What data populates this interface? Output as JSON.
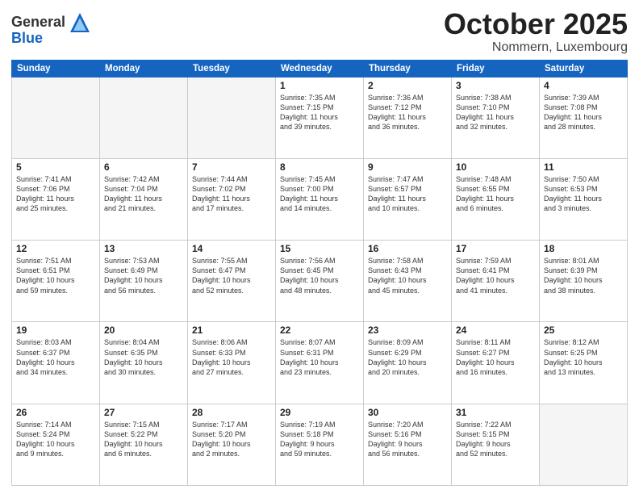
{
  "header": {
    "logo_general": "General",
    "logo_blue": "Blue",
    "month_title": "October 2025",
    "location": "Nommern, Luxembourg"
  },
  "weekdays": [
    "Sunday",
    "Monday",
    "Tuesday",
    "Wednesday",
    "Thursday",
    "Friday",
    "Saturday"
  ],
  "weeks": [
    [
      {
        "day": "",
        "info": ""
      },
      {
        "day": "",
        "info": ""
      },
      {
        "day": "",
        "info": ""
      },
      {
        "day": "1",
        "info": "Sunrise: 7:35 AM\nSunset: 7:15 PM\nDaylight: 11 hours\nand 39 minutes."
      },
      {
        "day": "2",
        "info": "Sunrise: 7:36 AM\nSunset: 7:12 PM\nDaylight: 11 hours\nand 36 minutes."
      },
      {
        "day": "3",
        "info": "Sunrise: 7:38 AM\nSunset: 7:10 PM\nDaylight: 11 hours\nand 32 minutes."
      },
      {
        "day": "4",
        "info": "Sunrise: 7:39 AM\nSunset: 7:08 PM\nDaylight: 11 hours\nand 28 minutes."
      }
    ],
    [
      {
        "day": "5",
        "info": "Sunrise: 7:41 AM\nSunset: 7:06 PM\nDaylight: 11 hours\nand 25 minutes."
      },
      {
        "day": "6",
        "info": "Sunrise: 7:42 AM\nSunset: 7:04 PM\nDaylight: 11 hours\nand 21 minutes."
      },
      {
        "day": "7",
        "info": "Sunrise: 7:44 AM\nSunset: 7:02 PM\nDaylight: 11 hours\nand 17 minutes."
      },
      {
        "day": "8",
        "info": "Sunrise: 7:45 AM\nSunset: 7:00 PM\nDaylight: 11 hours\nand 14 minutes."
      },
      {
        "day": "9",
        "info": "Sunrise: 7:47 AM\nSunset: 6:57 PM\nDaylight: 11 hours\nand 10 minutes."
      },
      {
        "day": "10",
        "info": "Sunrise: 7:48 AM\nSunset: 6:55 PM\nDaylight: 11 hours\nand 6 minutes."
      },
      {
        "day": "11",
        "info": "Sunrise: 7:50 AM\nSunset: 6:53 PM\nDaylight: 11 hours\nand 3 minutes."
      }
    ],
    [
      {
        "day": "12",
        "info": "Sunrise: 7:51 AM\nSunset: 6:51 PM\nDaylight: 10 hours\nand 59 minutes."
      },
      {
        "day": "13",
        "info": "Sunrise: 7:53 AM\nSunset: 6:49 PM\nDaylight: 10 hours\nand 56 minutes."
      },
      {
        "day": "14",
        "info": "Sunrise: 7:55 AM\nSunset: 6:47 PM\nDaylight: 10 hours\nand 52 minutes."
      },
      {
        "day": "15",
        "info": "Sunrise: 7:56 AM\nSunset: 6:45 PM\nDaylight: 10 hours\nand 48 minutes."
      },
      {
        "day": "16",
        "info": "Sunrise: 7:58 AM\nSunset: 6:43 PM\nDaylight: 10 hours\nand 45 minutes."
      },
      {
        "day": "17",
        "info": "Sunrise: 7:59 AM\nSunset: 6:41 PM\nDaylight: 10 hours\nand 41 minutes."
      },
      {
        "day": "18",
        "info": "Sunrise: 8:01 AM\nSunset: 6:39 PM\nDaylight: 10 hours\nand 38 minutes."
      }
    ],
    [
      {
        "day": "19",
        "info": "Sunrise: 8:03 AM\nSunset: 6:37 PM\nDaylight: 10 hours\nand 34 minutes."
      },
      {
        "day": "20",
        "info": "Sunrise: 8:04 AM\nSunset: 6:35 PM\nDaylight: 10 hours\nand 30 minutes."
      },
      {
        "day": "21",
        "info": "Sunrise: 8:06 AM\nSunset: 6:33 PM\nDaylight: 10 hours\nand 27 minutes."
      },
      {
        "day": "22",
        "info": "Sunrise: 8:07 AM\nSunset: 6:31 PM\nDaylight: 10 hours\nand 23 minutes."
      },
      {
        "day": "23",
        "info": "Sunrise: 8:09 AM\nSunset: 6:29 PM\nDaylight: 10 hours\nand 20 minutes."
      },
      {
        "day": "24",
        "info": "Sunrise: 8:11 AM\nSunset: 6:27 PM\nDaylight: 10 hours\nand 16 minutes."
      },
      {
        "day": "25",
        "info": "Sunrise: 8:12 AM\nSunset: 6:25 PM\nDaylight: 10 hours\nand 13 minutes."
      }
    ],
    [
      {
        "day": "26",
        "info": "Sunrise: 7:14 AM\nSunset: 5:24 PM\nDaylight: 10 hours\nand 9 minutes."
      },
      {
        "day": "27",
        "info": "Sunrise: 7:15 AM\nSunset: 5:22 PM\nDaylight: 10 hours\nand 6 minutes."
      },
      {
        "day": "28",
        "info": "Sunrise: 7:17 AM\nSunset: 5:20 PM\nDaylight: 10 hours\nand 2 minutes."
      },
      {
        "day": "29",
        "info": "Sunrise: 7:19 AM\nSunset: 5:18 PM\nDaylight: 9 hours\nand 59 minutes."
      },
      {
        "day": "30",
        "info": "Sunrise: 7:20 AM\nSunset: 5:16 PM\nDaylight: 9 hours\nand 56 minutes."
      },
      {
        "day": "31",
        "info": "Sunrise: 7:22 AM\nSunset: 5:15 PM\nDaylight: 9 hours\nand 52 minutes."
      },
      {
        "day": "",
        "info": ""
      }
    ]
  ]
}
